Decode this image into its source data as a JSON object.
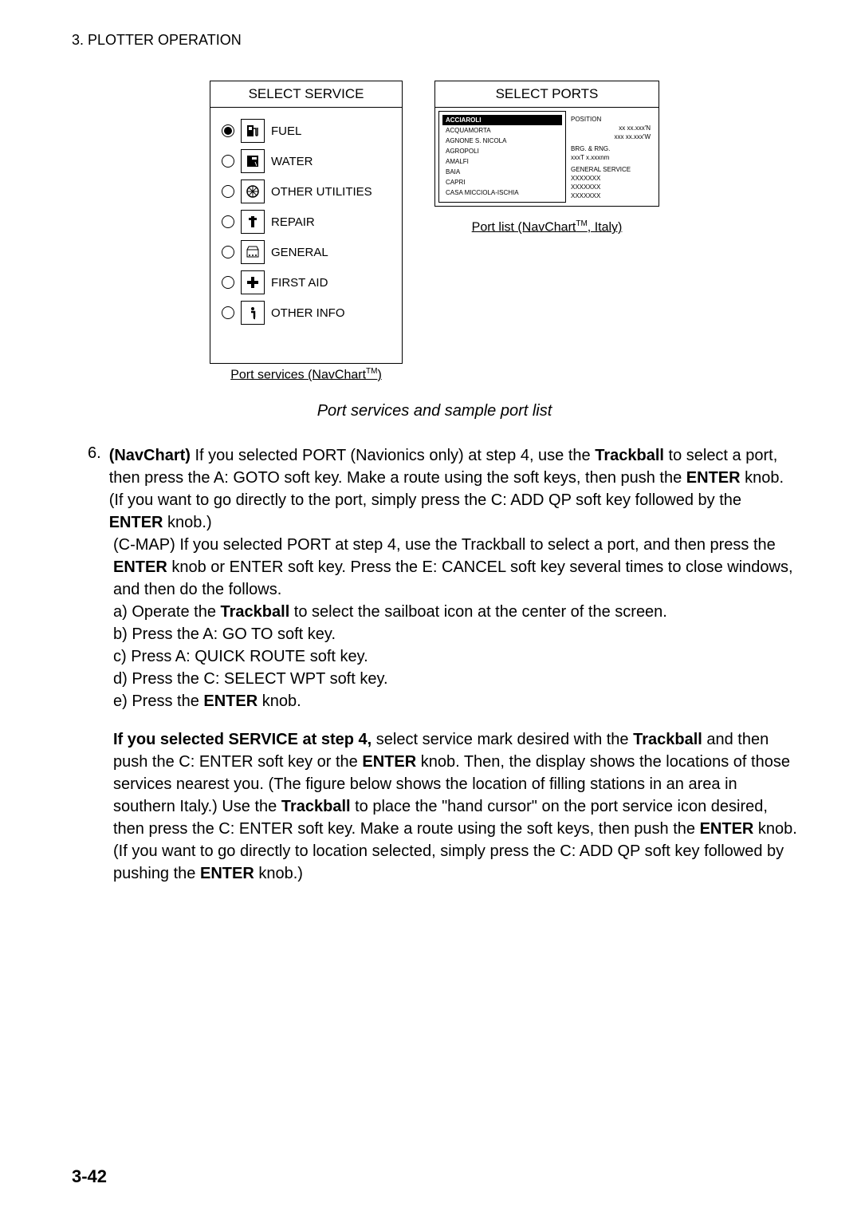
{
  "header": {
    "chapter": "3. PLOTTER OPERATION"
  },
  "select_service": {
    "title": "SELECT SERVICE",
    "items": [
      {
        "label": "FUEL",
        "selected": true,
        "icon": "fuel-pump"
      },
      {
        "label": "WATER",
        "selected": false,
        "icon": "faucet"
      },
      {
        "label": "OTHER UTILITIES",
        "selected": false,
        "icon": "utility"
      },
      {
        "label": "REPAIR",
        "selected": false,
        "icon": "wrench"
      },
      {
        "label": "GENERAL",
        "selected": false,
        "icon": "storefront"
      },
      {
        "label": "FIRST AID",
        "selected": false,
        "icon": "cross"
      },
      {
        "label": "OTHER INFO",
        "selected": false,
        "icon": "info"
      }
    ],
    "caption": "Port services (NavChart",
    "caption_tm": "TM",
    "caption_end": ")"
  },
  "select_ports": {
    "title": "SELECT PORTS",
    "ports": [
      "ACCIAROLI",
      "ACQUAMORTA",
      "AGNONE S. NICOLA",
      "AGROPOLI",
      "AMALFI",
      "BAIA",
      "CAPRI",
      "CASA MICCIOLA-ISCHIA"
    ],
    "info": {
      "position_label": "POSITION",
      "position_lat": "xx xx.xxx'N",
      "position_lon": "xxx xx.xxx'W",
      "brg_rng_label": "BRG. & RNG.",
      "brg_rng_val": "xxxT  x.xxxnm",
      "general_service_label": "GENERAL SERVICE",
      "svc1": "XXXXXXX",
      "svc2": "XXXXXXX",
      "svc3": "XXXXXXX"
    },
    "caption": "Port list (NavChart",
    "caption_tm": "TM",
    "caption_end": ", Italy)"
  },
  "main_caption": "Port services and sample port list",
  "step6": {
    "num": "6.",
    "line1a": "(NavChart)",
    "line1b": " If you selected PORT (Navionics only) at step 4, use the ",
    "line1c": "Trackball",
    "line1d": " to select a port, then press the A: GOTO soft key. Make a route using the soft keys, then push the ",
    "line1e": "ENTER",
    "line1f": " knob. (If you want to go directly to the port, simply press the C: ADD QP soft key followed by the ",
    "line1g": "ENTER",
    "line1h": " knob.)",
    "cmap1": "(C-MAP) If you selected PORT at step 4, use the Trackball to select a port, and then press the ",
    "cmap2": "ENTER",
    "cmap3": " knob or ENTER soft key. Press the E: CANCEL soft key several times to close windows, and then do the follows.",
    "sub_a": "a) Operate the ",
    "sub_a_bold": "Trackball",
    "sub_a_end": " to select the sailboat icon at the center of the screen.",
    "sub_b": "b) Press the A: GO TO soft key.",
    "sub_c": "c) Press A: QUICK ROUTE soft key.",
    "sub_d": "d) Press the C: SELECT WPT soft key.",
    "sub_e": "e) Press the ",
    "sub_e_bold": "ENTER",
    "sub_e_end": " knob.",
    "svc1": "If you selected SERVICE at step 4,",
    "svc2": " select service mark desired with the ",
    "svc3": "Trackball",
    "svc4": " and then push the C: ENTER soft key or the ",
    "svc5": "ENTER",
    "svc6": " knob. Then, the display shows the locations of those services nearest you. (The figure below shows the location of filling stations in an area in southern Italy.) Use the ",
    "svc7": "Trackball",
    "svc8": " to place the \"hand cursor\" on the port service icon desired, then press the C: ENTER soft key. Make a route using the soft keys, then push the ",
    "svc9": "ENTER",
    "svc10": " knob. (If you want to go directly to location selected, simply press the C: ADD QP soft key followed by pushing the ",
    "svc11": "ENTER",
    "svc12": " knob.)"
  },
  "footer": {
    "page": "3-42"
  }
}
